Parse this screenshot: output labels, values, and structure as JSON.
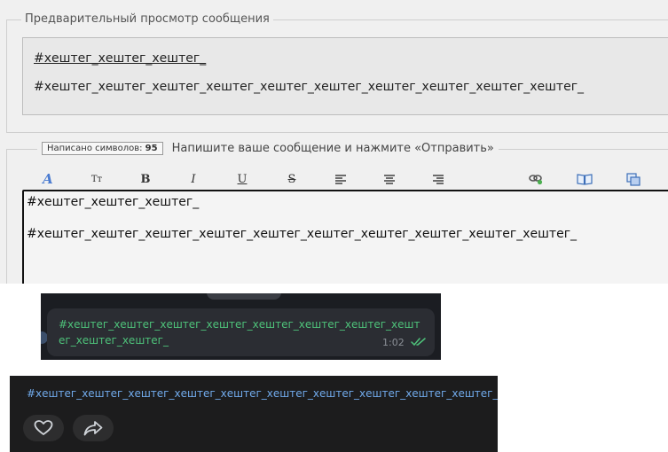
{
  "forum": {
    "preview_legend": "Предварительный просмотр сообщения",
    "preview_line1": "#хештег_хештег_хештег_",
    "preview_line2": "#хештег_хештег_хештег_хештег_хештег_хештег_хештег_хештег_хештег_хештег_",
    "char_count_label": "Написано символов:",
    "char_count_value": "95",
    "compose_prompt": "Напишите ваше сообщение и нажмите «Отправить»",
    "toolbar": {
      "font": "A",
      "size": "Tт",
      "bold": "B",
      "italic": "I",
      "underline": "U",
      "strike": "S"
    },
    "editor_line1": "#хештег_хештег_хештег_",
    "editor_line2": "#хештег_хештег_хештег_хештег_хештег_хештег_хештег_хештег_хештег_хештег_"
  },
  "telegram": {
    "message": "#хештег_хештег_хештег_хештег_хештег_хештег_хештег_хештег_хештег_хештег_",
    "time": "1:02"
  },
  "vk": {
    "post_text": "#хештег_хештег_хештег_хештег_хештег_хештег_хештег_хештег_хештег_хештег_"
  },
  "colors": {
    "telegram_text": "#4ec27a",
    "vk_link": "#71aaeb"
  }
}
